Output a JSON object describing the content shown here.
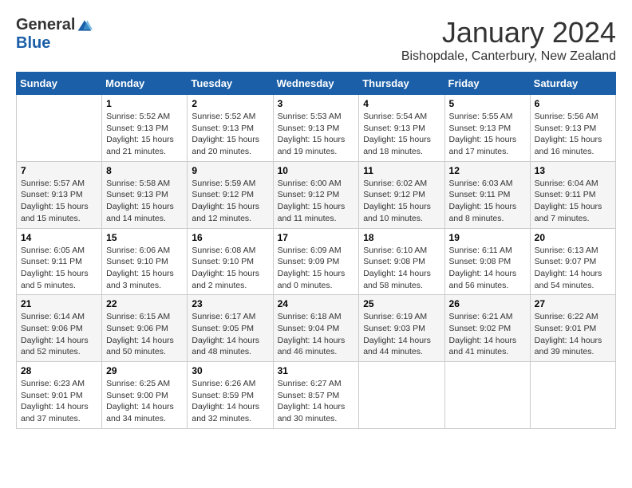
{
  "logo": {
    "general": "General",
    "blue": "Blue"
  },
  "title": "January 2024",
  "location": "Bishopdale, Canterbury, New Zealand",
  "days_header": [
    "Sunday",
    "Monday",
    "Tuesday",
    "Wednesday",
    "Thursday",
    "Friday",
    "Saturday"
  ],
  "weeks": [
    [
      {
        "day": "",
        "info": ""
      },
      {
        "day": "1",
        "info": "Sunrise: 5:52 AM\nSunset: 9:13 PM\nDaylight: 15 hours\nand 21 minutes."
      },
      {
        "day": "2",
        "info": "Sunrise: 5:52 AM\nSunset: 9:13 PM\nDaylight: 15 hours\nand 20 minutes."
      },
      {
        "day": "3",
        "info": "Sunrise: 5:53 AM\nSunset: 9:13 PM\nDaylight: 15 hours\nand 19 minutes."
      },
      {
        "day": "4",
        "info": "Sunrise: 5:54 AM\nSunset: 9:13 PM\nDaylight: 15 hours\nand 18 minutes."
      },
      {
        "day": "5",
        "info": "Sunrise: 5:55 AM\nSunset: 9:13 PM\nDaylight: 15 hours\nand 17 minutes."
      },
      {
        "day": "6",
        "info": "Sunrise: 5:56 AM\nSunset: 9:13 PM\nDaylight: 15 hours\nand 16 minutes."
      }
    ],
    [
      {
        "day": "7",
        "info": "Sunrise: 5:57 AM\nSunset: 9:13 PM\nDaylight: 15 hours\nand 15 minutes."
      },
      {
        "day": "8",
        "info": "Sunrise: 5:58 AM\nSunset: 9:13 PM\nDaylight: 15 hours\nand 14 minutes."
      },
      {
        "day": "9",
        "info": "Sunrise: 5:59 AM\nSunset: 9:12 PM\nDaylight: 15 hours\nand 12 minutes."
      },
      {
        "day": "10",
        "info": "Sunrise: 6:00 AM\nSunset: 9:12 PM\nDaylight: 15 hours\nand 11 minutes."
      },
      {
        "day": "11",
        "info": "Sunrise: 6:02 AM\nSunset: 9:12 PM\nDaylight: 15 hours\nand 10 minutes."
      },
      {
        "day": "12",
        "info": "Sunrise: 6:03 AM\nSunset: 9:11 PM\nDaylight: 15 hours\nand 8 minutes."
      },
      {
        "day": "13",
        "info": "Sunrise: 6:04 AM\nSunset: 9:11 PM\nDaylight: 15 hours\nand 7 minutes."
      }
    ],
    [
      {
        "day": "14",
        "info": "Sunrise: 6:05 AM\nSunset: 9:11 PM\nDaylight: 15 hours\nand 5 minutes."
      },
      {
        "day": "15",
        "info": "Sunrise: 6:06 AM\nSunset: 9:10 PM\nDaylight: 15 hours\nand 3 minutes."
      },
      {
        "day": "16",
        "info": "Sunrise: 6:08 AM\nSunset: 9:10 PM\nDaylight: 15 hours\nand 2 minutes."
      },
      {
        "day": "17",
        "info": "Sunrise: 6:09 AM\nSunset: 9:09 PM\nDaylight: 15 hours\nand 0 minutes."
      },
      {
        "day": "18",
        "info": "Sunrise: 6:10 AM\nSunset: 9:08 PM\nDaylight: 14 hours\nand 58 minutes."
      },
      {
        "day": "19",
        "info": "Sunrise: 6:11 AM\nSunset: 9:08 PM\nDaylight: 14 hours\nand 56 minutes."
      },
      {
        "day": "20",
        "info": "Sunrise: 6:13 AM\nSunset: 9:07 PM\nDaylight: 14 hours\nand 54 minutes."
      }
    ],
    [
      {
        "day": "21",
        "info": "Sunrise: 6:14 AM\nSunset: 9:06 PM\nDaylight: 14 hours\nand 52 minutes."
      },
      {
        "day": "22",
        "info": "Sunrise: 6:15 AM\nSunset: 9:06 PM\nDaylight: 14 hours\nand 50 minutes."
      },
      {
        "day": "23",
        "info": "Sunrise: 6:17 AM\nSunset: 9:05 PM\nDaylight: 14 hours\nand 48 minutes."
      },
      {
        "day": "24",
        "info": "Sunrise: 6:18 AM\nSunset: 9:04 PM\nDaylight: 14 hours\nand 46 minutes."
      },
      {
        "day": "25",
        "info": "Sunrise: 6:19 AM\nSunset: 9:03 PM\nDaylight: 14 hours\nand 44 minutes."
      },
      {
        "day": "26",
        "info": "Sunrise: 6:21 AM\nSunset: 9:02 PM\nDaylight: 14 hours\nand 41 minutes."
      },
      {
        "day": "27",
        "info": "Sunrise: 6:22 AM\nSunset: 9:01 PM\nDaylight: 14 hours\nand 39 minutes."
      }
    ],
    [
      {
        "day": "28",
        "info": "Sunrise: 6:23 AM\nSunset: 9:01 PM\nDaylight: 14 hours\nand 37 minutes."
      },
      {
        "day": "29",
        "info": "Sunrise: 6:25 AM\nSunset: 9:00 PM\nDaylight: 14 hours\nand 34 minutes."
      },
      {
        "day": "30",
        "info": "Sunrise: 6:26 AM\nSunset: 8:59 PM\nDaylight: 14 hours\nand 32 minutes."
      },
      {
        "day": "31",
        "info": "Sunrise: 6:27 AM\nSunset: 8:57 PM\nDaylight: 14 hours\nand 30 minutes."
      },
      {
        "day": "",
        "info": ""
      },
      {
        "day": "",
        "info": ""
      },
      {
        "day": "",
        "info": ""
      }
    ]
  ]
}
